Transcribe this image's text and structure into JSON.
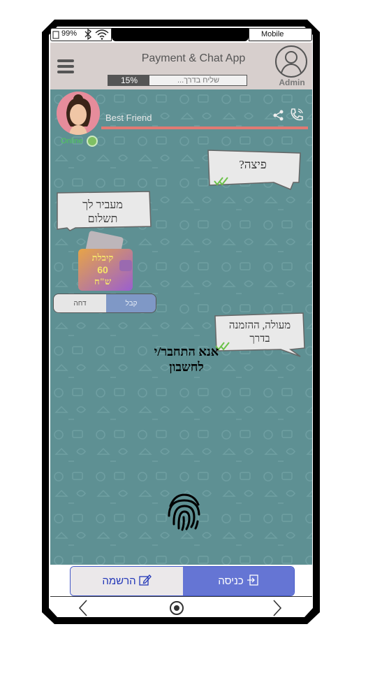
{
  "status_bar": {
    "battery": "99%",
    "network_label": "Mobile"
  },
  "header": {
    "title": "Payment & Chat App",
    "progress_percent": 15,
    "progress_label": "15%",
    "progress_text": "שליח בדרך...",
    "admin_label": "Admin"
  },
  "contact": {
    "name": "Best Friend",
    "status": "Online"
  },
  "messages": {
    "m1": "פיצה?",
    "m2_line1": "מעביר לך",
    "m2_line2": "תשלום",
    "m3_line1": "מעולה, ההזמנה",
    "m3_line2": "בדרך"
  },
  "payment_card": {
    "line1": "קיבלת",
    "line2": "60",
    "line3": "ש\"ח",
    "reject_label": "דחה",
    "accept_label": "קבל"
  },
  "login_prompt": {
    "line1": "אנא התחבר/י",
    "line2": "לחשבון"
  },
  "actions": {
    "signup_label": "הרשמה",
    "login_label": "כניסה"
  },
  "colors": {
    "chat_background": "#5e9093",
    "header_background": "#d7cfcd",
    "accent_red": "#e07a73",
    "login_button": "#6575d4"
  },
  "icons": [
    "battery-icon",
    "bluetooth-icon",
    "wifi-icon",
    "hamburger-menu-icon",
    "admin-avatar-icon",
    "share-icon",
    "phone-icon",
    "online-indicator-icon",
    "double-check-icon",
    "fingerprint-icon",
    "edit-icon",
    "login-icon",
    "back-chevron-icon",
    "home-button-icon",
    "forward-chevron-icon"
  ]
}
